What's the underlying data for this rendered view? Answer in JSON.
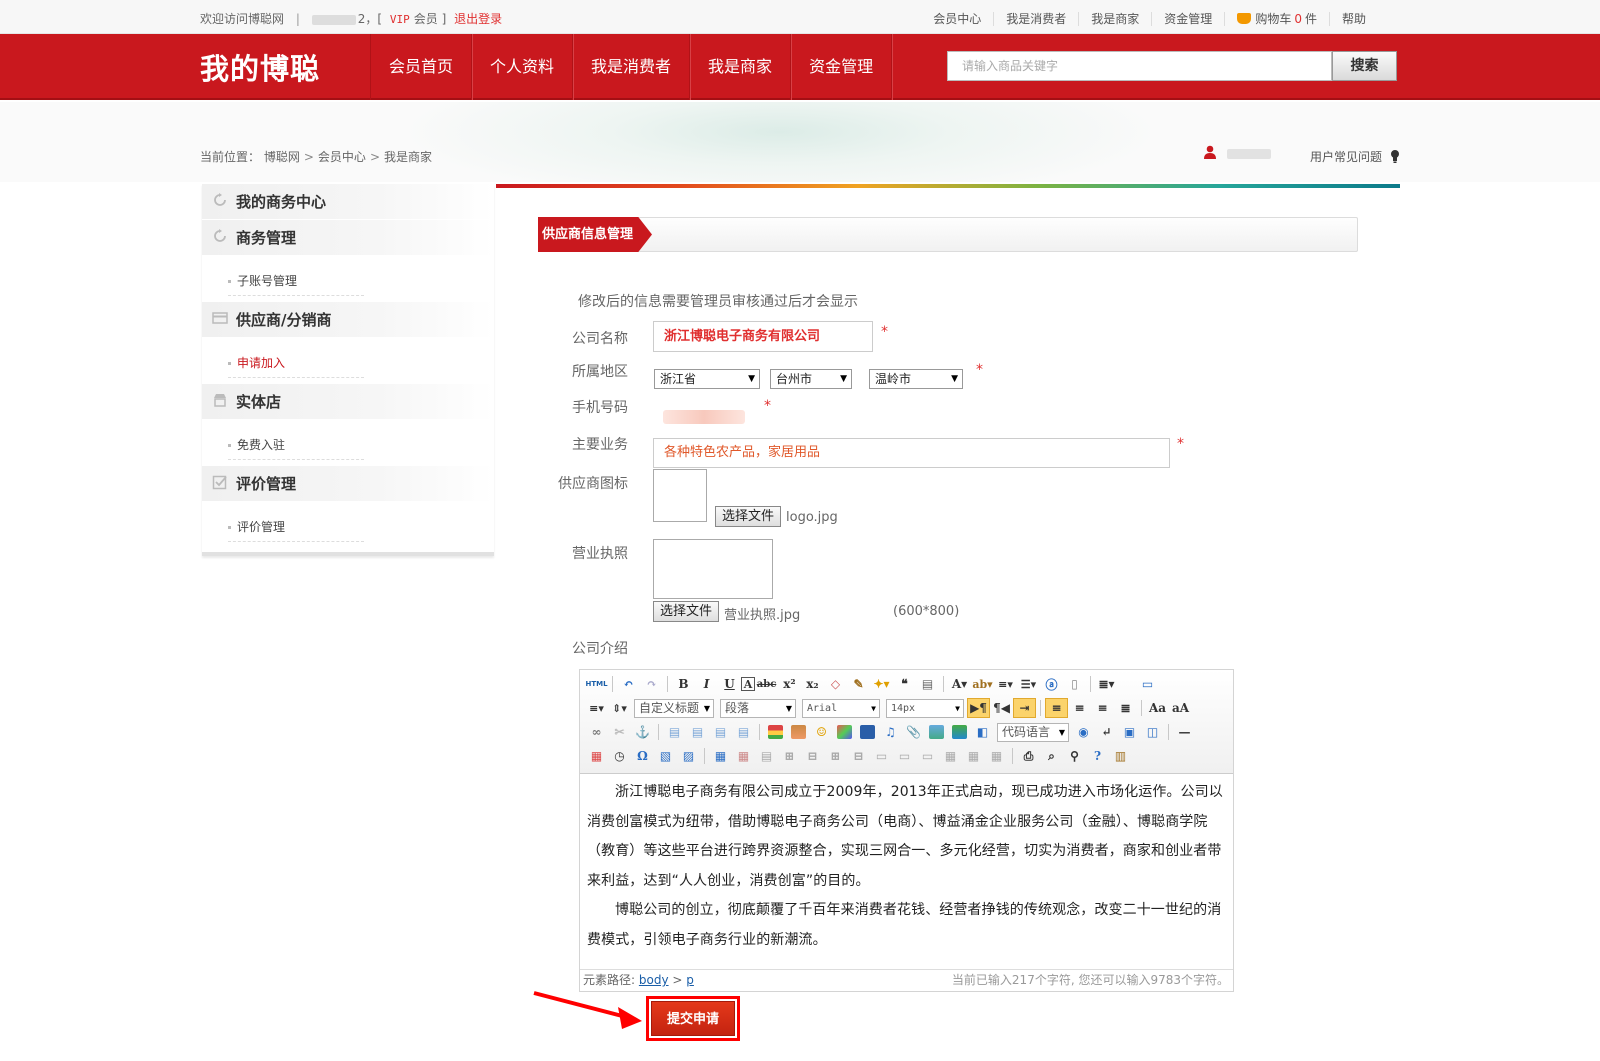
{
  "topbar": {
    "welcome": "欢迎访问博聪网",
    "sep": "|",
    "name_tail": "2",
    "bracket_open": "，[",
    "vip": "VIP",
    "member": "会员",
    "bracket_close": "]",
    "logout": "退出登录",
    "links": [
      "会员中心",
      "我是消费者",
      "我是商家",
      "资金管理"
    ],
    "cart_label": "购物车",
    "cart_count": "0",
    "cart_unit": "件",
    "help": "帮助"
  },
  "header": {
    "logo": "我的博聪",
    "nav": [
      "会员首页",
      "个人资料",
      "我是消费者",
      "我是商家",
      "资金管理"
    ],
    "search_placeholder": "请输入商品关键字",
    "search_button": "搜索"
  },
  "breadcrumb": {
    "prefix": "当前位置：",
    "items": [
      "博聪网",
      "会员中心",
      "我是商家"
    ],
    "arrow": ">"
  },
  "user_help": "用户常见问题",
  "sidebar": {
    "groups": [
      {
        "title": "我的商务中心",
        "items": []
      },
      {
        "title": "商务管理",
        "items": [
          "子账号管理"
        ]
      },
      {
        "title": "供应商/分销商",
        "items": [
          "申请加入"
        ]
      },
      {
        "title": "实体店",
        "items": [
          "免费入驻"
        ]
      },
      {
        "title": "评价管理",
        "items": [
          "评价管理"
        ]
      }
    ],
    "active_item": "申请加入"
  },
  "form": {
    "tab_title": "供应商信息管理",
    "note": "修改后的信息需要管理员审核通过后才会显示",
    "required_mark": "*",
    "labels": {
      "company": "公司名称",
      "region": "所属地区",
      "phone": "手机号码",
      "business": "主要业务",
      "logo": "供应商图标",
      "license": "营业执照",
      "intro": "公司介绍"
    },
    "company_value": "浙江博聪电子商务有限公司",
    "province": "浙江省",
    "city": "台州市",
    "district": "温岭市",
    "business_value": "各种特色农产品，家居用品",
    "file_button": "选择文件",
    "logo_file": "logo.jpg",
    "license_file": "营业执照.jpg",
    "license_size": "(600*800)",
    "submit": "提交申请"
  },
  "editor": {
    "toolbar": {
      "html_btn": "HTML",
      "custom_heading": "自定义标题",
      "paragraph": "段落",
      "font": "Arial",
      "size": "14px",
      "code_lang": "代码语言"
    },
    "paragraphs": [
      "浙江博聪电子商务有限公司成立于2009年，2013年正式启动，现已成功进入市场化运作。公司以消费创富模式为纽带，借助博聪电子商务公司（电商）、博益涌金企业服务公司（金融）、博聪商学院（教育）等这些平台进行跨界资源整合，实现三网合一、多元化经营，切实为消费者，商家和创业者带来利益，达到“人人创业，消费创富”的目的。",
      "博聪公司的创立，彻底颠覆了千百年来消费者花钱、经营者挣钱的传统观念，改变二十一世纪的消费模式，引领电子商务行业的新潮流。"
    ],
    "path_label": "元素路径:",
    "path_body": "body",
    "path_sep": ">",
    "path_p": "p",
    "count_text": "当前已输入217个字符, 您还可以输入9783个字符。"
  },
  "colors": {
    "brand_red": "#c9181e",
    "required_red": "#e03030",
    "highlight_frame": "#ff0000"
  }
}
